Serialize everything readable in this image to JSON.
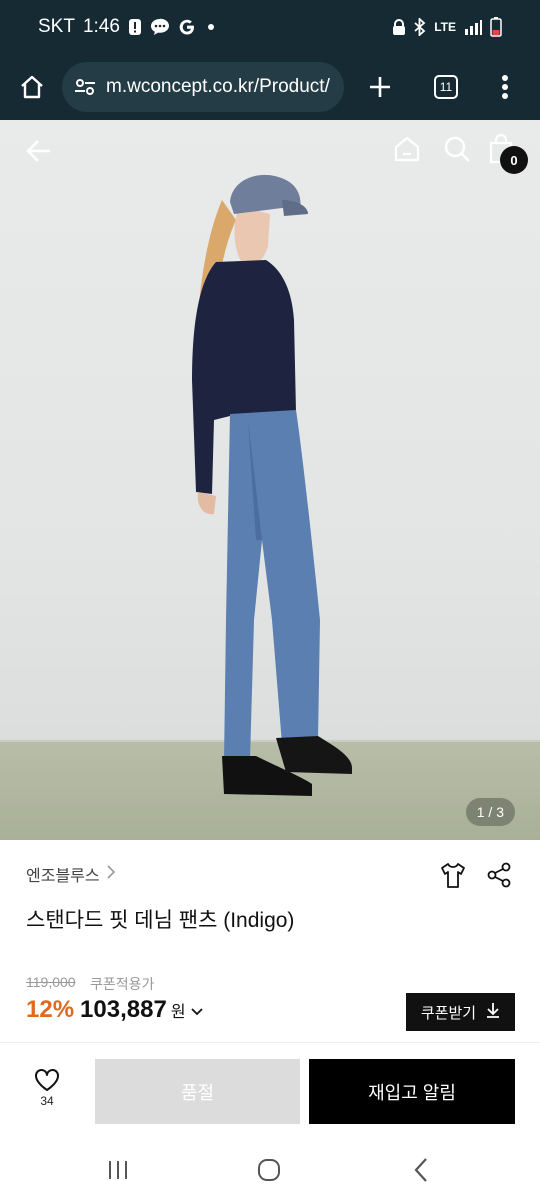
{
  "status_bar": {
    "carrier": "SKT",
    "time": "1:46",
    "network": "LTE"
  },
  "browser": {
    "url": "m.wconcept.co.kr/Product/",
    "tab_count": "11"
  },
  "hero": {
    "pager": "1 / 3",
    "cart_count": "0"
  },
  "product": {
    "brand": "엔조블루스",
    "title": "스탠다드 핏 데님 팬츠 (Indigo)",
    "original_price": "119,000",
    "coupon_note": "쿠폰적용가",
    "discount": "12%",
    "price": "103,887",
    "currency": "원",
    "coupon_button": "쿠폰받기"
  },
  "actions": {
    "like_count": "34",
    "soldout_label": "품절",
    "restock_label": "재입고 알림"
  },
  "colors": {
    "accent_discount": "#e0681f",
    "header_bg": "#152a33"
  }
}
